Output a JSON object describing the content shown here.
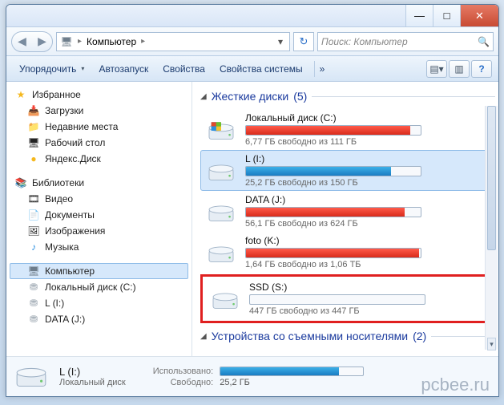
{
  "titlebar": {
    "min": "—",
    "max": "□",
    "close": "✕"
  },
  "nav": {
    "back": "◀",
    "forward": "▶",
    "crumb_root": "Компьютер",
    "crumb_sep": "▸",
    "refresh": "↻",
    "search_placeholder": "Поиск: Компьютер",
    "search_icon": "🔍"
  },
  "toolbar": {
    "organize": "Упорядочить",
    "autorun": "Автозапуск",
    "properties": "Свойства",
    "sysprops": "Свойства системы",
    "view_icon": "▤",
    "preview_icon": "▥",
    "help_icon": "?"
  },
  "sidebar": {
    "favorites": {
      "head": "Избранное",
      "items": [
        "Загрузки",
        "Недавние места",
        "Рабочий стол",
        "Яндекс.Диск"
      ]
    },
    "libraries": {
      "head": "Библиотеки",
      "items": [
        "Видео",
        "Документы",
        "Изображения",
        "Музыка"
      ]
    },
    "computer": {
      "head": "Компьютер",
      "items": [
        "Локальный диск (C:)",
        "L (I:)",
        "DATA (J:)"
      ]
    }
  },
  "main": {
    "group1": {
      "title": "Жесткие диски",
      "count": "(5)",
      "tri": "◢"
    },
    "drives": [
      {
        "name": "Локальный диск (C:)",
        "stat": "6,77 ГБ свободно из 111 ГБ",
        "fill": 94,
        "color": "red",
        "sel": false,
        "os": true
      },
      {
        "name": "L (I:)",
        "stat": "25,2 ГБ свободно из 150 ГБ",
        "fill": 83,
        "color": "blue",
        "sel": true,
        "os": false
      },
      {
        "name": "DATA (J:)",
        "stat": "56,1 ГБ свободно из 624 ГБ",
        "fill": 91,
        "color": "red",
        "sel": false,
        "os": false
      },
      {
        "name": "foto (K:)",
        "stat": "1,64 ГБ свободно из 1,06 ТБ",
        "fill": 99,
        "color": "red",
        "sel": false,
        "os": false
      },
      {
        "name": "SSD (S:)",
        "stat": "447 ГБ свободно из 447 ГБ",
        "fill": 0,
        "color": "gray",
        "sel": false,
        "os": false,
        "highlight": true
      }
    ],
    "group2": {
      "title": "Устройства со съемными носителями",
      "count": "(2)",
      "tri": "◢"
    }
  },
  "status": {
    "name": "L (I:)",
    "type": "Локальный диск",
    "used_lbl": "Использовано:",
    "free_lbl": "Свободно:",
    "free_val": "25,2 ГБ",
    "fill": 83
  },
  "watermark": "pcbee.ru"
}
